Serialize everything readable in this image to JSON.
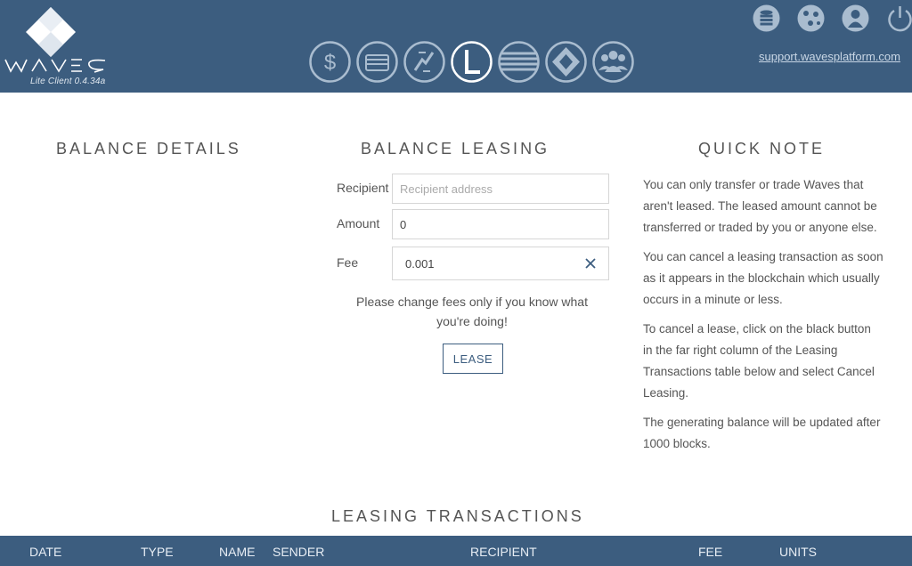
{
  "app": {
    "version": "Lite Client 0.4.34a",
    "brand_color": "#3c5d7f"
  },
  "nav": {
    "items": [
      {
        "icon": "dollar-icon",
        "label": ""
      },
      {
        "icon": "wallet-icon",
        "label": ""
      },
      {
        "icon": "exchange-icon",
        "label": ""
      },
      {
        "icon": "leasing-icon",
        "label": "",
        "active": true
      },
      {
        "icon": "list-icon",
        "label": ""
      },
      {
        "icon": "dex-icon",
        "label": ""
      },
      {
        "icon": "community-icon",
        "label": ""
      }
    ]
  },
  "top_right": {
    "icons": [
      "database-icon",
      "network-icon",
      "account-icon",
      "power-icon"
    ],
    "support_link": "support.wavesplatform.com"
  },
  "sections": {
    "balance_details": "BALANCE DETAILS",
    "balance_leasing": "BALANCE LEASING",
    "quick_note": "QUICK NOTE",
    "leasing_transactions": "LEASING TRANSACTIONS"
  },
  "form": {
    "recipient_label": "Recipient",
    "recipient_placeholder": "Recipient address",
    "amount_label": "Amount",
    "amount_value": "0",
    "fee_label": "Fee",
    "fee_value": "0.001",
    "hint": "Please change fees only if you know what you're doing!",
    "lease_button": "LEASE"
  },
  "quick_note": {
    "paragraphs": [
      "You can only transfer or trade Waves that aren't leased. The leased amount cannot be transferred or traded by you or anyone else.",
      "You can cancel a leasing transaction as soon as it appears in the blockchain which usually occurs in a minute or less.",
      "To cancel a lease, click on the black button in the far right column of the Leasing Transactions table below and select Cancel Leasing.",
      "The generating balance will be updated after 1000 blocks."
    ]
  },
  "table": {
    "columns": [
      "DATE",
      "TYPE",
      "NAME",
      "SENDER",
      "RECIPIENT",
      "FEE",
      "UNITS"
    ]
  }
}
